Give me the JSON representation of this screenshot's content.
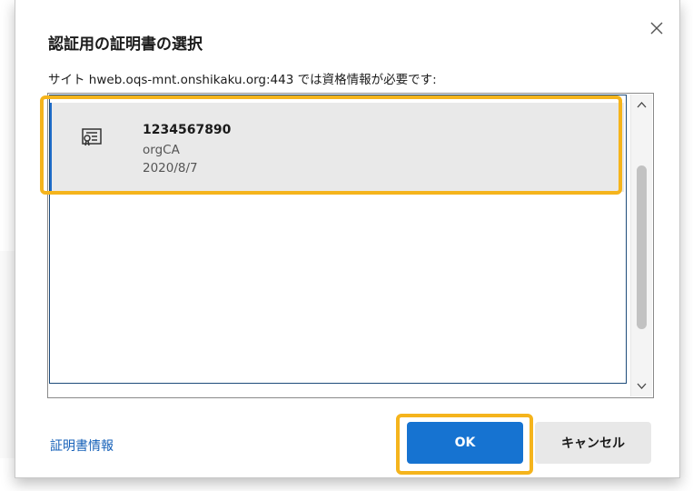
{
  "dialog": {
    "title": "認証用の証明書の選択",
    "subtitle": "サイト hweb.oqs-mnt.onshikaku.org:443 では資格情報が必要です:",
    "close_icon": "close-icon"
  },
  "certificates": [
    {
      "name": "1234567890",
      "issuer": "orgCA",
      "date": "2020/8/7",
      "icon": "certificate-icon",
      "selected": true
    }
  ],
  "footer": {
    "cert_info_link": "証明書情報",
    "ok_label": "OK",
    "cancel_label": "キャンセル"
  },
  "colors": {
    "accent": "#1673d1",
    "highlight": "#f5b41c",
    "link": "#1560b8",
    "selected_bg": "#e9e9e9"
  }
}
